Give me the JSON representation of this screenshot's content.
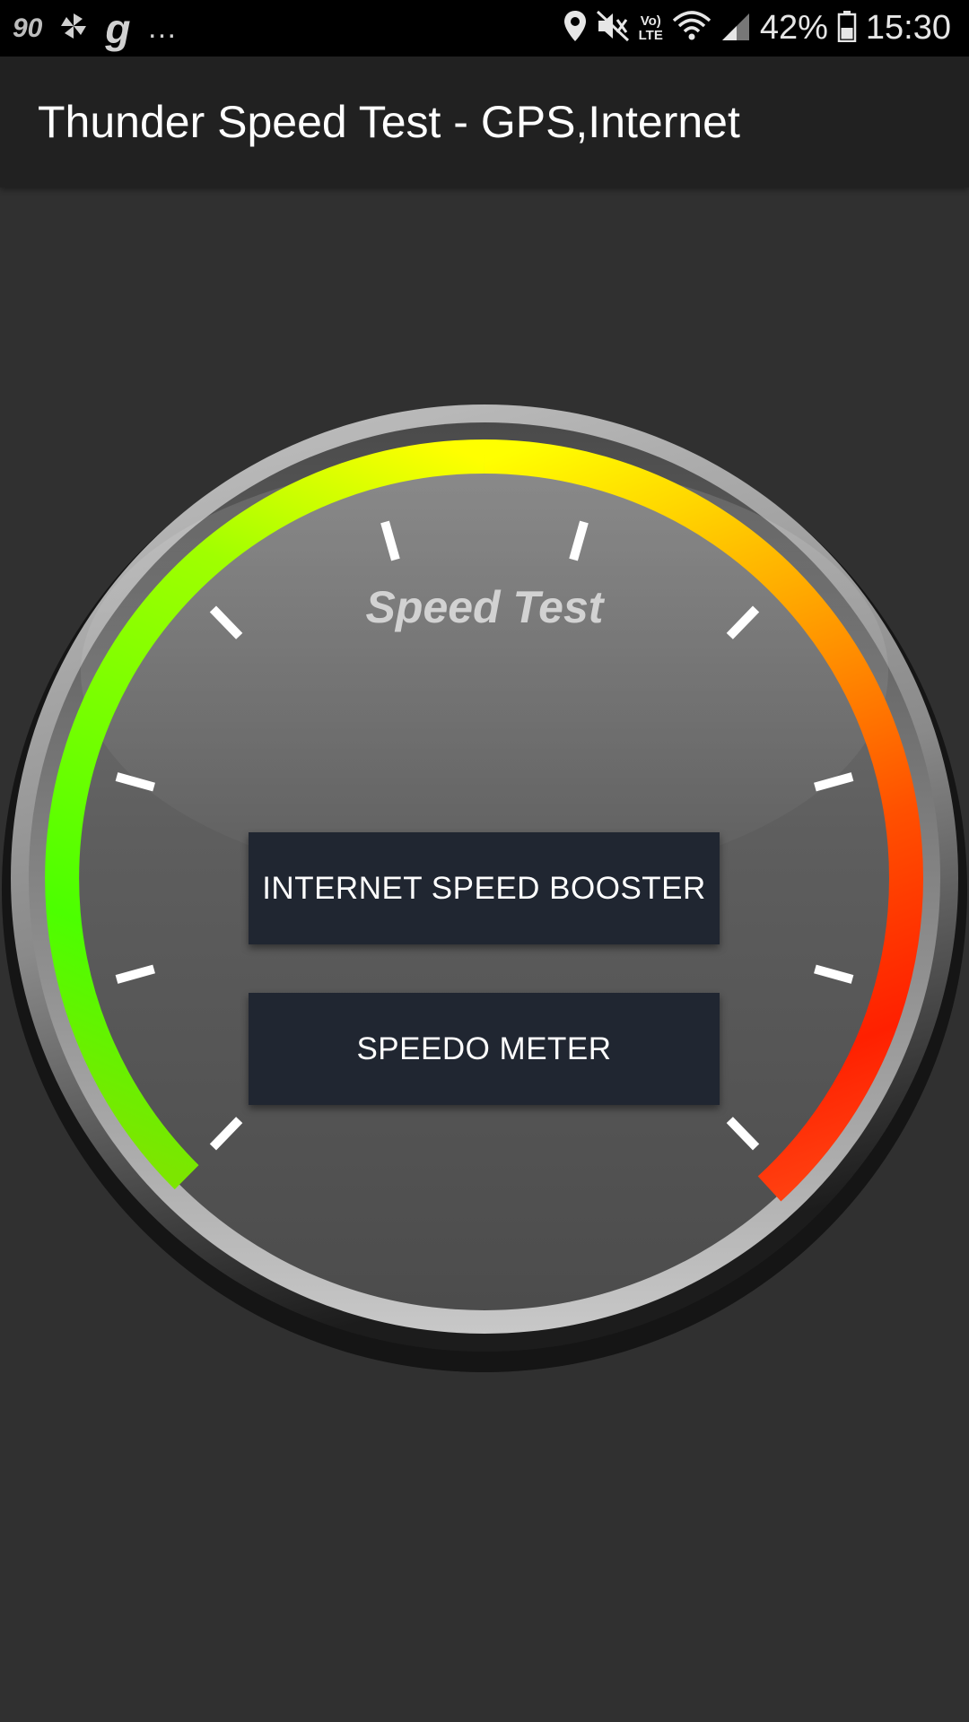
{
  "status_bar": {
    "left_badge": "90",
    "left_letter": "g",
    "overflow": "…",
    "battery_percent": "42%",
    "time": "15:30",
    "volte_top": "Vo)",
    "volte_bottom": "LTE",
    "icons": [
      "notification-90-icon",
      "pinwheel-icon",
      "g-app-icon",
      "location-icon",
      "mute-icon",
      "volte-icon",
      "wifi-icon",
      "signal-icon",
      "battery-icon"
    ]
  },
  "app_bar": {
    "title": "Thunder Speed Test - GPS,Internet"
  },
  "gauge": {
    "label": "Speed Test",
    "arc_colors": [
      "#4cff00",
      "#ffff00",
      "#ff8c00",
      "#ff2000"
    ]
  },
  "buttons": {
    "booster": "INTERNET SPEED BOOSTER",
    "meter": "SPEEDO METER"
  },
  "colors": {
    "background": "#303030",
    "app_bar": "#212121",
    "button": "#202631"
  }
}
